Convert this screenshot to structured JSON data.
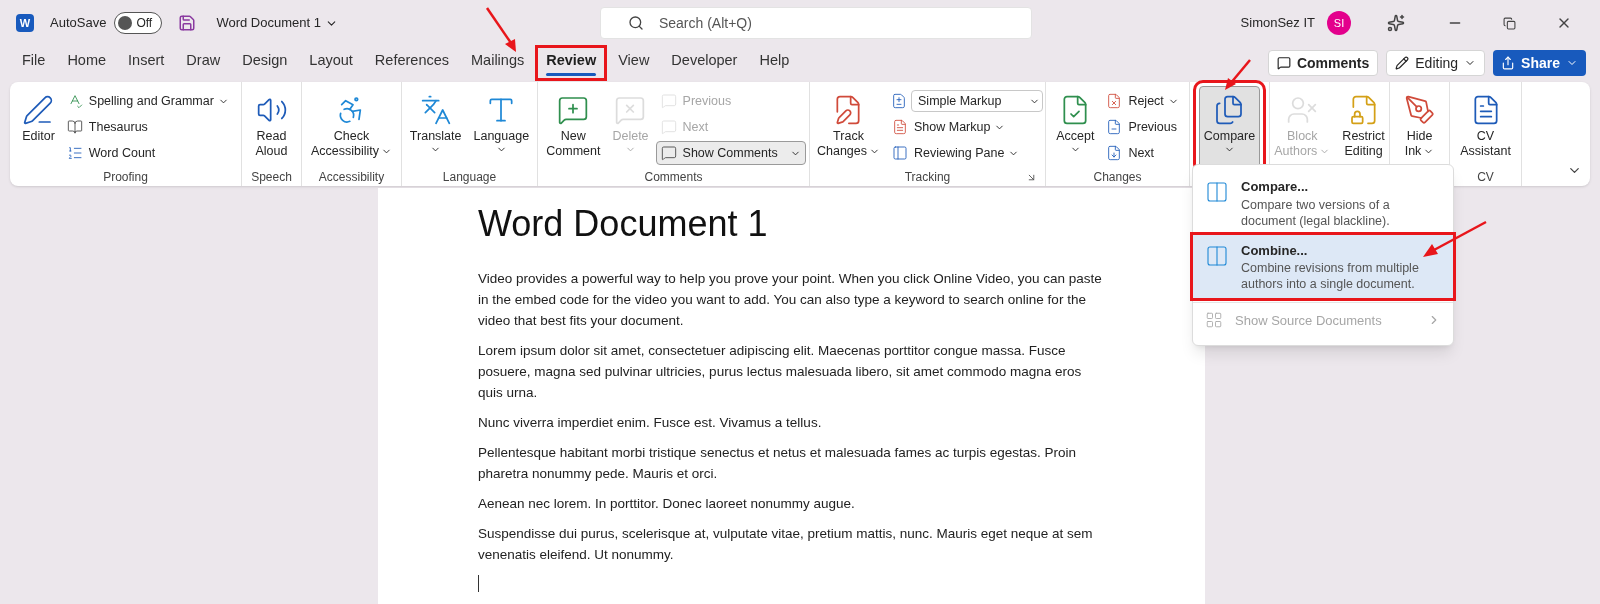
{
  "title_bar": {
    "app_logo": "W",
    "autosave_label": "AutoSave",
    "autosave": {
      "on": false,
      "label": "Off"
    },
    "document_title": "Word Document 1",
    "search": {
      "placeholder": "Search (Alt+Q)"
    },
    "user_name": "SimonSez IT",
    "avatar": "SI"
  },
  "tabs": [
    {
      "label": "File",
      "selected": false,
      "highlighted": false
    },
    {
      "label": "Home",
      "selected": false,
      "highlighted": false
    },
    {
      "label": "Insert",
      "selected": false,
      "highlighted": false
    },
    {
      "label": "Draw",
      "selected": false,
      "highlighted": false
    },
    {
      "label": "Design",
      "selected": false,
      "highlighted": false
    },
    {
      "label": "Layout",
      "selected": false,
      "highlighted": false
    },
    {
      "label": "References",
      "selected": false,
      "highlighted": false
    },
    {
      "label": "Mailings",
      "selected": false,
      "highlighted": false
    },
    {
      "label": "Review",
      "selected": true,
      "highlighted": true
    },
    {
      "label": "View",
      "selected": false,
      "highlighted": false
    },
    {
      "label": "Developer",
      "selected": false,
      "highlighted": false
    },
    {
      "label": "Help",
      "selected": false,
      "highlighted": false
    }
  ],
  "actions": {
    "comments": "Comments",
    "editing": "Editing",
    "share": "Share"
  },
  "ribbon": {
    "groups": [
      {
        "label": "Proofing",
        "items": [
          {
            "kind": "large",
            "lines": [
              "Editor"
            ],
            "disabled": false,
            "pressed": false
          },
          {
            "kind": "small",
            "label": "Spelling and Grammar",
            "dropdown": true,
            "disabled": false,
            "pressed": false
          },
          {
            "kind": "small",
            "label": "Thesaurus",
            "disabled": false,
            "pressed": false
          },
          {
            "kind": "small",
            "label": "Word Count",
            "disabled": false,
            "pressed": false
          }
        ]
      },
      {
        "label": "Speech",
        "items": [
          {
            "kind": "large",
            "lines": [
              "Read",
              "Aloud"
            ],
            "disabled": false,
            "pressed": false
          }
        ]
      },
      {
        "label": "Accessibility",
        "items": [
          {
            "kind": "large",
            "lines": [
              "Check",
              "Accessibility"
            ],
            "dropdown": true,
            "disabled": false,
            "pressed": false
          }
        ]
      },
      {
        "label": "Language",
        "items": [
          {
            "kind": "large",
            "lines": [
              "Translate"
            ],
            "dropdown": true,
            "disabled": false,
            "pressed": false
          },
          {
            "kind": "large",
            "lines": [
              "Language"
            ],
            "dropdown": true,
            "disabled": false,
            "pressed": false
          }
        ]
      },
      {
        "label": "Comments",
        "items": [
          {
            "kind": "large",
            "lines": [
              "New",
              "Comment"
            ],
            "disabled": false,
            "pressed": false
          },
          {
            "kind": "large",
            "lines": [
              "Delete"
            ],
            "dropdown": true,
            "disabled": true,
            "pressed": false
          },
          {
            "kind": "small",
            "label": "Previous",
            "disabled": true,
            "pressed": false
          },
          {
            "kind": "small",
            "label": "Next",
            "disabled": true,
            "pressed": false
          },
          {
            "kind": "small",
            "label": "Show Comments",
            "dropdown": true,
            "disabled": false,
            "pressed": true
          }
        ]
      },
      {
        "label": "Tracking",
        "launcher": true,
        "items": [
          {
            "kind": "large",
            "lines": [
              "Track",
              "Changes"
            ],
            "dropdown": true,
            "disabled": false,
            "pressed": false
          },
          {
            "kind": "select",
            "label": "Simple Markup"
          },
          {
            "kind": "small",
            "label": "Show Markup",
            "dropdown": true,
            "disabled": false,
            "pressed": false
          },
          {
            "kind": "small",
            "label": "Reviewing Pane",
            "dropdown": true,
            "disabled": false,
            "pressed": false
          }
        ]
      },
      {
        "label": "Changes",
        "items": [
          {
            "kind": "large",
            "lines": [
              "Accept"
            ],
            "dropdown": true,
            "disabled": false,
            "pressed": false
          },
          {
            "kind": "small",
            "label": "Reject",
            "dropdown": true,
            "disabled": false,
            "pressed": false
          },
          {
            "kind": "small",
            "label": "Previous",
            "disabled": false,
            "pressed": false
          },
          {
            "kind": "small",
            "label": "Next",
            "disabled": false,
            "pressed": false
          }
        ]
      },
      {
        "items": [
          {
            "kind": "large",
            "lines": [
              "Compare"
            ],
            "dropdown": true,
            "disabled": false,
            "pressed": true,
            "highlighted": true
          }
        ]
      },
      {
        "items": [
          {
            "kind": "large",
            "lines": [
              "Block",
              "Authors"
            ],
            "dropdown": true,
            "disabled": true,
            "pressed": false
          },
          {
            "kind": "large",
            "lines": [
              "Restrict",
              "Editing"
            ],
            "disabled": false,
            "pressed": false
          }
        ]
      },
      {
        "items": [
          {
            "kind": "large",
            "lines": [
              "Hide",
              "Ink"
            ],
            "dropdown": true,
            "disabled": false,
            "pressed": false
          }
        ]
      },
      {
        "label": "CV",
        "items": [
          {
            "kind": "large",
            "lines": [
              "CV",
              "Assistant"
            ],
            "disabled": false,
            "pressed": false
          }
        ]
      }
    ]
  },
  "compare_menu": {
    "items": [
      {
        "title": "Compare...",
        "description": "Compare two versions of a document (legal blackline).",
        "selected": false,
        "highlighted": false,
        "disabled": false
      },
      {
        "title": "Combine...",
        "description": "Combine revisions from multiple authors into a single document.",
        "selected": true,
        "highlighted": true,
        "disabled": false
      },
      {
        "title": "Show Source Documents",
        "selected": false,
        "highlighted": false,
        "disabled": true,
        "submenu": true
      }
    ]
  },
  "document": {
    "heading": "Word Document 1",
    "paragraphs": [
      "Video provides a powerful way to help you prove your point. When you click Online Video, you can paste in the embed code for the video you want to add. You can also type a keyword to search online for the video that best fits your document.",
      "Lorem ipsum dolor sit amet, consectetuer adipiscing elit. Maecenas porttitor congue massa. Fusce posuere, magna sed pulvinar ultricies, purus lectus malesuada libero, sit amet commodo magna eros quis urna.",
      "Nunc viverra imperdiet enim. Fusce est. Vivamus a tellus.",
      "Pellentesque habitant morbi tristique senectus et netus et malesuada fames ac turpis egestas. Proin pharetra nonummy pede. Mauris et orci.",
      "Aenean nec lorem. In porttitor. Donec laoreet nonummy augue.",
      "Suspendisse dui purus, scelerisque at, vulputate vitae, pretium mattis, nunc. Mauris eget neque at sem venenatis eleifend. Ut nonummy."
    ]
  }
}
